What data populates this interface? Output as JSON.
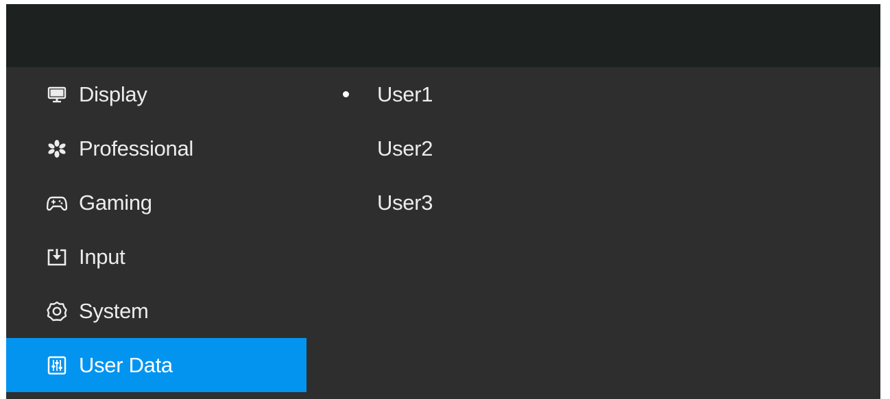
{
  "menu": {
    "items": [
      {
        "label": "Display",
        "icon": "monitor-icon",
        "active": false
      },
      {
        "label": "Professional",
        "icon": "aperture-icon",
        "active": false
      },
      {
        "label": "Gaming",
        "icon": "gamepad-icon",
        "active": false
      },
      {
        "label": "Input",
        "icon": "input-icon",
        "active": false
      },
      {
        "label": "System",
        "icon": "gear-icon",
        "active": false
      },
      {
        "label": "User Data",
        "icon": "sliders-icon",
        "active": true
      }
    ]
  },
  "submenu": {
    "items": [
      {
        "label": "User1",
        "selected": true
      },
      {
        "label": "User2",
        "selected": false
      },
      {
        "label": "User3",
        "selected": false
      }
    ]
  },
  "colors": {
    "header": "#1d2221",
    "panel": "#2e2e2e",
    "accent": "#0394f0",
    "text": "#ececec"
  }
}
